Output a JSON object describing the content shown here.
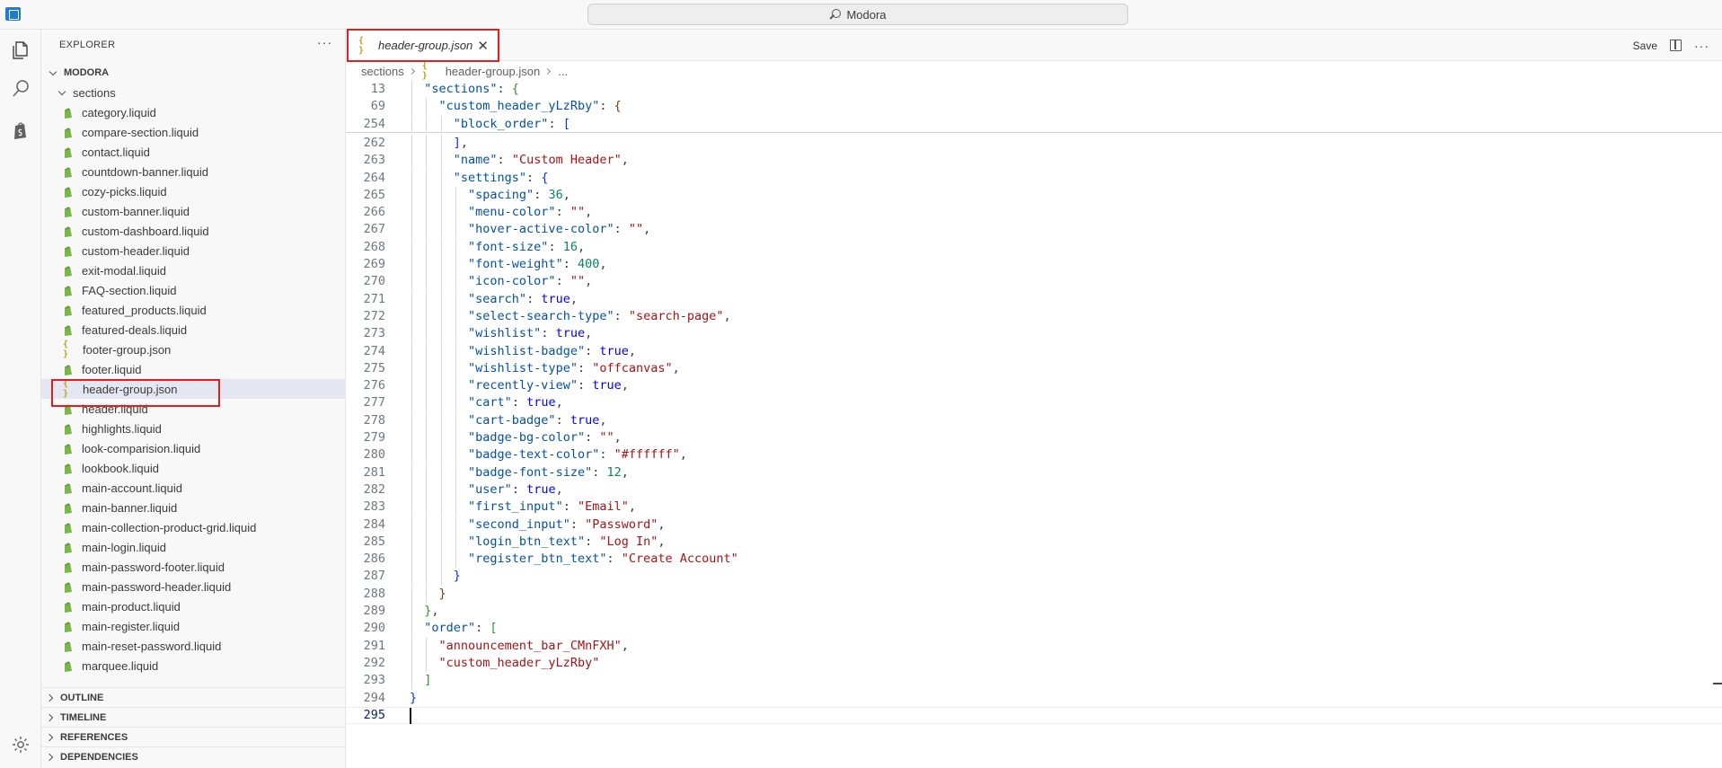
{
  "titlebar": {
    "search_text": "Modora"
  },
  "sidebar": {
    "title": "EXPLORER",
    "root_folder": "MODORA",
    "subfolder": "sections",
    "files": [
      {
        "name": "category.liquid",
        "type": "liquid"
      },
      {
        "name": "compare-section.liquid",
        "type": "liquid"
      },
      {
        "name": "contact.liquid",
        "type": "liquid"
      },
      {
        "name": "countdown-banner.liquid",
        "type": "liquid"
      },
      {
        "name": "cozy-picks.liquid",
        "type": "liquid"
      },
      {
        "name": "custom-banner.liquid",
        "type": "liquid"
      },
      {
        "name": "custom-dashboard.liquid",
        "type": "liquid"
      },
      {
        "name": "custom-header.liquid",
        "type": "liquid"
      },
      {
        "name": "exit-modal.liquid",
        "type": "liquid"
      },
      {
        "name": "FAQ-section.liquid",
        "type": "liquid"
      },
      {
        "name": "featured_products.liquid",
        "type": "liquid"
      },
      {
        "name": "featured-deals.liquid",
        "type": "liquid"
      },
      {
        "name": "footer-group.json",
        "type": "json"
      },
      {
        "name": "footer.liquid",
        "type": "liquid"
      },
      {
        "name": "header-group.json",
        "type": "json",
        "active": true
      },
      {
        "name": "header.liquid",
        "type": "liquid"
      },
      {
        "name": "highlights.liquid",
        "type": "liquid"
      },
      {
        "name": "look-comparision.liquid",
        "type": "liquid"
      },
      {
        "name": "lookbook.liquid",
        "type": "liquid"
      },
      {
        "name": "main-account.liquid",
        "type": "liquid"
      },
      {
        "name": "main-banner.liquid",
        "type": "liquid"
      },
      {
        "name": "main-collection-product-grid.liquid",
        "type": "liquid"
      },
      {
        "name": "main-login.liquid",
        "type": "liquid"
      },
      {
        "name": "main-password-footer.liquid",
        "type": "liquid"
      },
      {
        "name": "main-password-header.liquid",
        "type": "liquid"
      },
      {
        "name": "main-product.liquid",
        "type": "liquid"
      },
      {
        "name": "main-register.liquid",
        "type": "liquid"
      },
      {
        "name": "main-reset-password.liquid",
        "type": "liquid"
      },
      {
        "name": "marquee.liquid",
        "type": "liquid"
      }
    ],
    "panels": [
      "OUTLINE",
      "TIMELINE",
      "REFERENCES",
      "DEPENDENCIES"
    ]
  },
  "editor": {
    "tab_label": "header-group.json",
    "save_label": "Save",
    "breadcrumb": [
      "sections",
      "header-group.json",
      "..."
    ],
    "lines": [
      {
        "n": "13",
        "indent": 1,
        "tokens": [
          [
            "k",
            "\"sections\""
          ],
          [
            "p",
            ": "
          ],
          [
            "br2",
            "{"
          ]
        ]
      },
      {
        "n": "69",
        "indent": 2,
        "tokens": [
          [
            "k",
            "\"custom_header_yLzRby\""
          ],
          [
            "p",
            ": "
          ],
          [
            "br3",
            "{"
          ]
        ]
      },
      {
        "n": "254",
        "indent": 3,
        "tokens": [
          [
            "k",
            "\"block_order\""
          ],
          [
            "p",
            ": "
          ],
          [
            "br1",
            "["
          ]
        ]
      },
      {
        "n": "262",
        "indent": 3,
        "tokens": [
          [
            "br1",
            "]"
          ],
          [
            "p",
            ","
          ]
        ]
      },
      {
        "n": "263",
        "indent": 3,
        "tokens": [
          [
            "k",
            "\"name\""
          ],
          [
            "p",
            ": "
          ],
          [
            "s",
            "\"Custom Header\""
          ],
          [
            "p",
            ","
          ]
        ]
      },
      {
        "n": "264",
        "indent": 3,
        "tokens": [
          [
            "k",
            "\"settings\""
          ],
          [
            "p",
            ": "
          ],
          [
            "br1",
            "{"
          ]
        ]
      },
      {
        "n": "265",
        "indent": 4,
        "tokens": [
          [
            "k",
            "\"spacing\""
          ],
          [
            "p",
            ": "
          ],
          [
            "n",
            "36"
          ],
          [
            "p",
            ","
          ]
        ]
      },
      {
        "n": "266",
        "indent": 4,
        "tokens": [
          [
            "k",
            "\"menu-color\""
          ],
          [
            "p",
            ": "
          ],
          [
            "s",
            "\"\""
          ],
          [
            "p",
            ","
          ]
        ]
      },
      {
        "n": "267",
        "indent": 4,
        "tokens": [
          [
            "k",
            "\"hover-active-color\""
          ],
          [
            "p",
            ": "
          ],
          [
            "s",
            "\"\""
          ],
          [
            "p",
            ","
          ]
        ]
      },
      {
        "n": "268",
        "indent": 4,
        "tokens": [
          [
            "k",
            "\"font-size\""
          ],
          [
            "p",
            ": "
          ],
          [
            "n",
            "16"
          ],
          [
            "p",
            ","
          ]
        ]
      },
      {
        "n": "269",
        "indent": 4,
        "tokens": [
          [
            "k",
            "\"font-weight\""
          ],
          [
            "p",
            ": "
          ],
          [
            "n",
            "400"
          ],
          [
            "p",
            ","
          ]
        ]
      },
      {
        "n": "270",
        "indent": 4,
        "tokens": [
          [
            "k",
            "\"icon-color\""
          ],
          [
            "p",
            ": "
          ],
          [
            "s",
            "\"\""
          ],
          [
            "p",
            ","
          ]
        ]
      },
      {
        "n": "271",
        "indent": 4,
        "tokens": [
          [
            "k",
            "\"search\""
          ],
          [
            "p",
            ": "
          ],
          [
            "b",
            "true"
          ],
          [
            "p",
            ","
          ]
        ]
      },
      {
        "n": "272",
        "indent": 4,
        "tokens": [
          [
            "k",
            "\"select-search-type\""
          ],
          [
            "p",
            ": "
          ],
          [
            "s",
            "\"search-page\""
          ],
          [
            "p",
            ","
          ]
        ]
      },
      {
        "n": "273",
        "indent": 4,
        "tokens": [
          [
            "k",
            "\"wishlist\""
          ],
          [
            "p",
            ": "
          ],
          [
            "b",
            "true"
          ],
          [
            "p",
            ","
          ]
        ]
      },
      {
        "n": "274",
        "indent": 4,
        "tokens": [
          [
            "k",
            "\"wishlist-badge\""
          ],
          [
            "p",
            ": "
          ],
          [
            "b",
            "true"
          ],
          [
            "p",
            ","
          ]
        ]
      },
      {
        "n": "275",
        "indent": 4,
        "tokens": [
          [
            "k",
            "\"wishlist-type\""
          ],
          [
            "p",
            ": "
          ],
          [
            "s",
            "\"offcanvas\""
          ],
          [
            "p",
            ","
          ]
        ]
      },
      {
        "n": "276",
        "indent": 4,
        "tokens": [
          [
            "k",
            "\"recently-view\""
          ],
          [
            "p",
            ": "
          ],
          [
            "b",
            "true"
          ],
          [
            "p",
            ","
          ]
        ]
      },
      {
        "n": "277",
        "indent": 4,
        "tokens": [
          [
            "k",
            "\"cart\""
          ],
          [
            "p",
            ": "
          ],
          [
            "b",
            "true"
          ],
          [
            "p",
            ","
          ]
        ]
      },
      {
        "n": "278",
        "indent": 4,
        "tokens": [
          [
            "k",
            "\"cart-badge\""
          ],
          [
            "p",
            ": "
          ],
          [
            "b",
            "true"
          ],
          [
            "p",
            ","
          ]
        ]
      },
      {
        "n": "279",
        "indent": 4,
        "tokens": [
          [
            "k",
            "\"badge-bg-color\""
          ],
          [
            "p",
            ": "
          ],
          [
            "s",
            "\"\""
          ],
          [
            "p",
            ","
          ]
        ]
      },
      {
        "n": "280",
        "indent": 4,
        "tokens": [
          [
            "k",
            "\"badge-text-color\""
          ],
          [
            "p",
            ": "
          ],
          [
            "s",
            "\"#ffffff\""
          ],
          [
            "p",
            ","
          ]
        ]
      },
      {
        "n": "281",
        "indent": 4,
        "tokens": [
          [
            "k",
            "\"badge-font-size\""
          ],
          [
            "p",
            ": "
          ],
          [
            "n",
            "12"
          ],
          [
            "p",
            ","
          ]
        ]
      },
      {
        "n": "282",
        "indent": 4,
        "tokens": [
          [
            "k",
            "\"user\""
          ],
          [
            "p",
            ": "
          ],
          [
            "b",
            "true"
          ],
          [
            "p",
            ","
          ]
        ]
      },
      {
        "n": "283",
        "indent": 4,
        "tokens": [
          [
            "k",
            "\"first_input\""
          ],
          [
            "p",
            ": "
          ],
          [
            "s",
            "\"Email\""
          ],
          [
            "p",
            ","
          ]
        ]
      },
      {
        "n": "284",
        "indent": 4,
        "tokens": [
          [
            "k",
            "\"second_input\""
          ],
          [
            "p",
            ": "
          ],
          [
            "s",
            "\"Password\""
          ],
          [
            "p",
            ","
          ]
        ]
      },
      {
        "n": "285",
        "indent": 4,
        "tokens": [
          [
            "k",
            "\"login_btn_text\""
          ],
          [
            "p",
            ": "
          ],
          [
            "s",
            "\"Log In\""
          ],
          [
            "p",
            ","
          ]
        ]
      },
      {
        "n": "286",
        "indent": 4,
        "tokens": [
          [
            "k",
            "\"register_btn_text\""
          ],
          [
            "p",
            ": "
          ],
          [
            "s",
            "\"Create Account\""
          ]
        ]
      },
      {
        "n": "287",
        "indent": 3,
        "tokens": [
          [
            "br1",
            "}"
          ]
        ]
      },
      {
        "n": "288",
        "indent": 2,
        "tokens": [
          [
            "br3",
            "}"
          ]
        ]
      },
      {
        "n": "289",
        "indent": 1,
        "tokens": [
          [
            "br2",
            "}"
          ],
          [
            "p",
            ","
          ]
        ]
      },
      {
        "n": "290",
        "indent": 1,
        "tokens": [
          [
            "k",
            "\"order\""
          ],
          [
            "p",
            ": "
          ],
          [
            "br2",
            "["
          ]
        ]
      },
      {
        "n": "291",
        "indent": 2,
        "tokens": [
          [
            "s",
            "\"announcement_bar_CMnFXH\""
          ],
          [
            "p",
            ","
          ]
        ]
      },
      {
        "n": "292",
        "indent": 2,
        "tokens": [
          [
            "s",
            "\"custom_header_yLzRby\""
          ]
        ]
      },
      {
        "n": "293",
        "indent": 1,
        "tokens": [
          [
            "br2",
            "]"
          ]
        ]
      },
      {
        "n": "294",
        "indent": 0,
        "tokens": [
          [
            "br1",
            "}"
          ]
        ]
      },
      {
        "n": "295",
        "indent": 0,
        "tokens": []
      }
    ]
  },
  "colors": {
    "key": "#0451a5",
    "string": "#a31515",
    "number": "#098658",
    "boolean": "#0000ff",
    "highlight_box": "#e02020",
    "active_row": "#e4e6f1"
  }
}
